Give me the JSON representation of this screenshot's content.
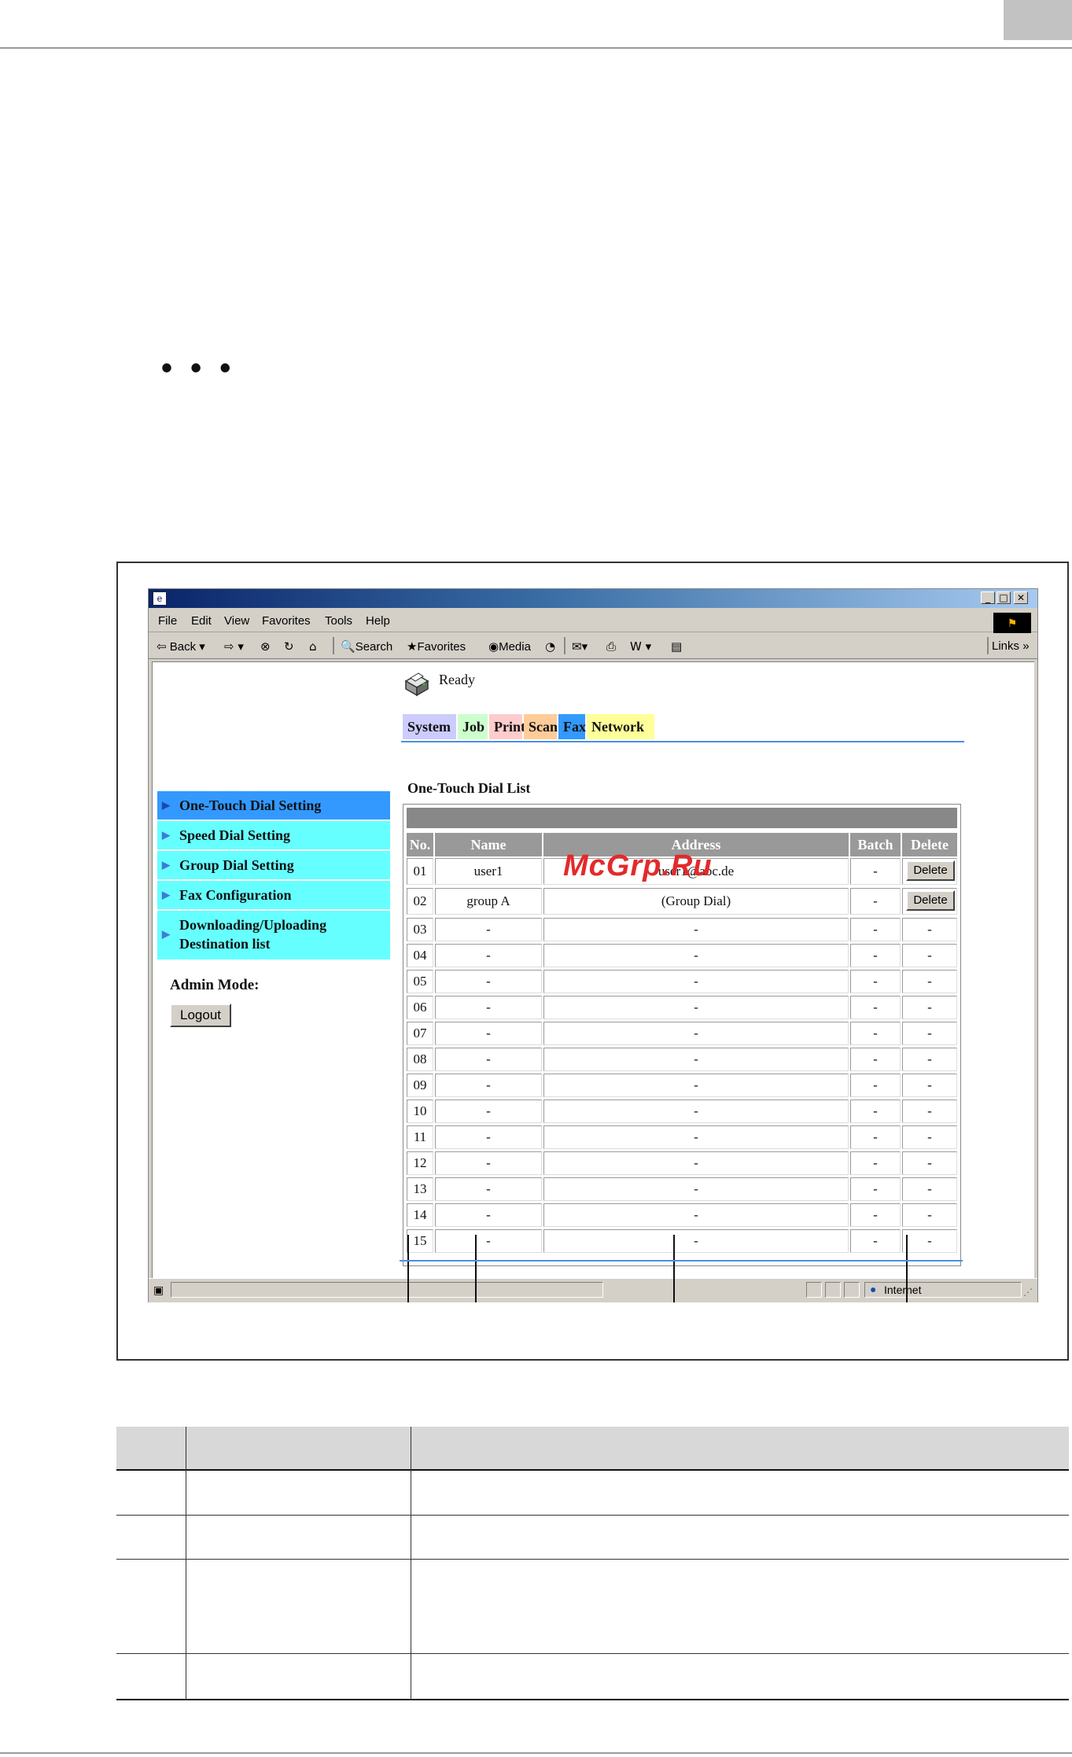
{
  "page": {
    "ellipsis": "• • •"
  },
  "browser": {
    "menu": [
      "File",
      "Edit",
      "View",
      "Favorites",
      "Tools",
      "Help"
    ],
    "toolbar": {
      "back": "Back",
      "search": "Search",
      "favorites": "Favorites",
      "media": "Media",
      "links": "Links"
    },
    "status_zone": "Internet"
  },
  "device": {
    "status": "Ready",
    "tabs": [
      {
        "label": "System",
        "color": "#ccccff"
      },
      {
        "label": "Job",
        "color": "#ccffcc"
      },
      {
        "label": "Print",
        "color": "#ffcccc"
      },
      {
        "label": "Scan",
        "color": "#ffcc99"
      },
      {
        "label": "Fax",
        "color": "#3399ff"
      },
      {
        "label": "Network",
        "color": "#ffff99"
      }
    ],
    "sidebar": [
      {
        "label": "One-Touch Dial Setting",
        "active": true
      },
      {
        "label": "Speed Dial Setting",
        "active": false
      },
      {
        "label": "Group Dial Setting",
        "active": false
      },
      {
        "label": "Fax Configuration",
        "active": false
      },
      {
        "label_line1": "Downloading/Uploading",
        "label_line2": "Destination list",
        "active": false
      }
    ],
    "admin_mode_label": "Admin Mode:",
    "logout_label": "Logout"
  },
  "list": {
    "title": "One-Touch Dial List",
    "headers": [
      "No.",
      "Name",
      "Address",
      "Batch",
      "Delete"
    ],
    "rows": [
      {
        "no": "01",
        "name": "user1",
        "address": "user1@abc.de",
        "batch": "-",
        "delete": "Delete"
      },
      {
        "no": "02",
        "name": "group A",
        "address": "(Group Dial)",
        "batch": "-",
        "delete": "Delete"
      },
      {
        "no": "03",
        "name": "-",
        "address": "-",
        "batch": "-",
        "delete": "-"
      },
      {
        "no": "04",
        "name": "-",
        "address": "-",
        "batch": "-",
        "delete": "-"
      },
      {
        "no": "05",
        "name": "-",
        "address": "-",
        "batch": "-",
        "delete": "-"
      },
      {
        "no": "06",
        "name": "-",
        "address": "-",
        "batch": "-",
        "delete": "-"
      },
      {
        "no": "07",
        "name": "-",
        "address": "-",
        "batch": "-",
        "delete": "-"
      },
      {
        "no": "08",
        "name": "-",
        "address": "-",
        "batch": "-",
        "delete": "-"
      },
      {
        "no": "09",
        "name": "-",
        "address": "-",
        "batch": "-",
        "delete": "-"
      },
      {
        "no": "10",
        "name": "-",
        "address": "-",
        "batch": "-",
        "delete": "-"
      },
      {
        "no": "11",
        "name": "-",
        "address": "-",
        "batch": "-",
        "delete": "-"
      },
      {
        "no": "12",
        "name": "-",
        "address": "-",
        "batch": "-",
        "delete": "-"
      },
      {
        "no": "13",
        "name": "-",
        "address": "-",
        "batch": "-",
        "delete": "-"
      },
      {
        "no": "14",
        "name": "-",
        "address": "-",
        "batch": "-",
        "delete": "-"
      },
      {
        "no": "15",
        "name": "-",
        "address": "-",
        "batch": "-",
        "delete": "-"
      }
    ]
  },
  "watermark": "McGrp.Ru"
}
